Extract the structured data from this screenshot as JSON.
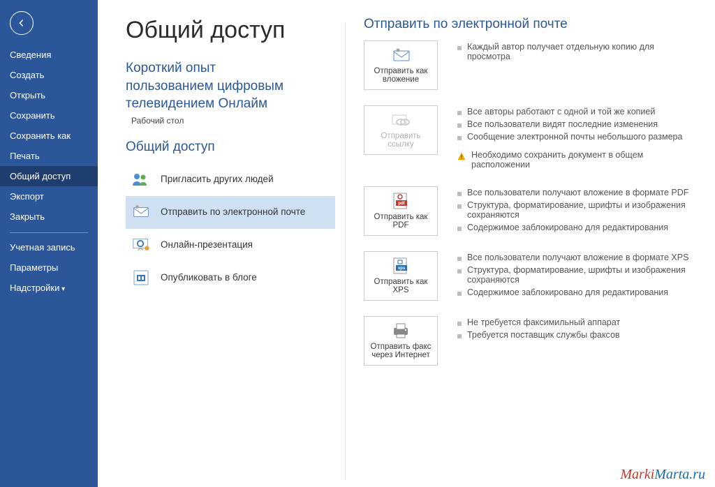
{
  "sidebar": {
    "items": [
      "Сведения",
      "Создать",
      "Открыть",
      "Сохранить",
      "Сохранить как",
      "Печать",
      "Общий доступ",
      "Экспорт",
      "Закрыть"
    ],
    "activeIndex": 6,
    "bottom": [
      "Учетная запись",
      "Параметры",
      "Надстройки"
    ]
  },
  "page": {
    "title": "Общий доступ",
    "docTitleLines": [
      "Короткий опыт",
      "пользованием цифровым",
      "телевидением Онлайм"
    ],
    "docLocation": "Рабочий стол",
    "shareHeading": "Общий доступ",
    "shareList": [
      {
        "key": "invite",
        "label": "Пригласить других людей"
      },
      {
        "key": "email",
        "label": "Отправить по электронной почте"
      },
      {
        "key": "present",
        "label": "Онлайн-презентация"
      },
      {
        "key": "blog",
        "label": "Опубликовать в блоге"
      }
    ],
    "shareSelectedIndex": 1
  },
  "right": {
    "heading": "Отправить по электронной почте",
    "options": [
      {
        "key": "attach",
        "label": "Отправить как вложение",
        "disabled": false,
        "bullets": [
          "Каждый автор получает отдельную копию для просмотра"
        ],
        "warn": null
      },
      {
        "key": "link",
        "label": "Отправить ссылку",
        "disabled": true,
        "bullets": [
          "Все авторы работают с одной и той же копией",
          "Все пользователи видят последние изменения",
          "Сообщение электронной почты небольшого размера"
        ],
        "warn": "Необходимо сохранить документ в общем расположении"
      },
      {
        "key": "pdf",
        "label": "Отправить как PDF",
        "disabled": false,
        "bullets": [
          "Все пользователи получают вложение в формате PDF",
          "Структура, форматирование, шрифты и изображения сохраняются",
          "Содержимое заблокировано для редактирования"
        ],
        "warn": null
      },
      {
        "key": "xps",
        "label": "Отправить как XPS",
        "disabled": false,
        "bullets": [
          "Все пользователи получают вложение в формате XPS",
          "Структура, форматирование, шрифты и изображения сохраняются",
          "Содержимое заблокировано для редактирования"
        ],
        "warn": null
      },
      {
        "key": "fax",
        "label": "Отправить факс через Интернет",
        "disabled": false,
        "bullets": [
          "Не требуется факсимильный аппарат",
          "Требуется поставщик службы факсов"
        ],
        "warn": null
      }
    ]
  },
  "watermark": {
    "p1": "Marki",
    "p2": "Marta.ru"
  }
}
